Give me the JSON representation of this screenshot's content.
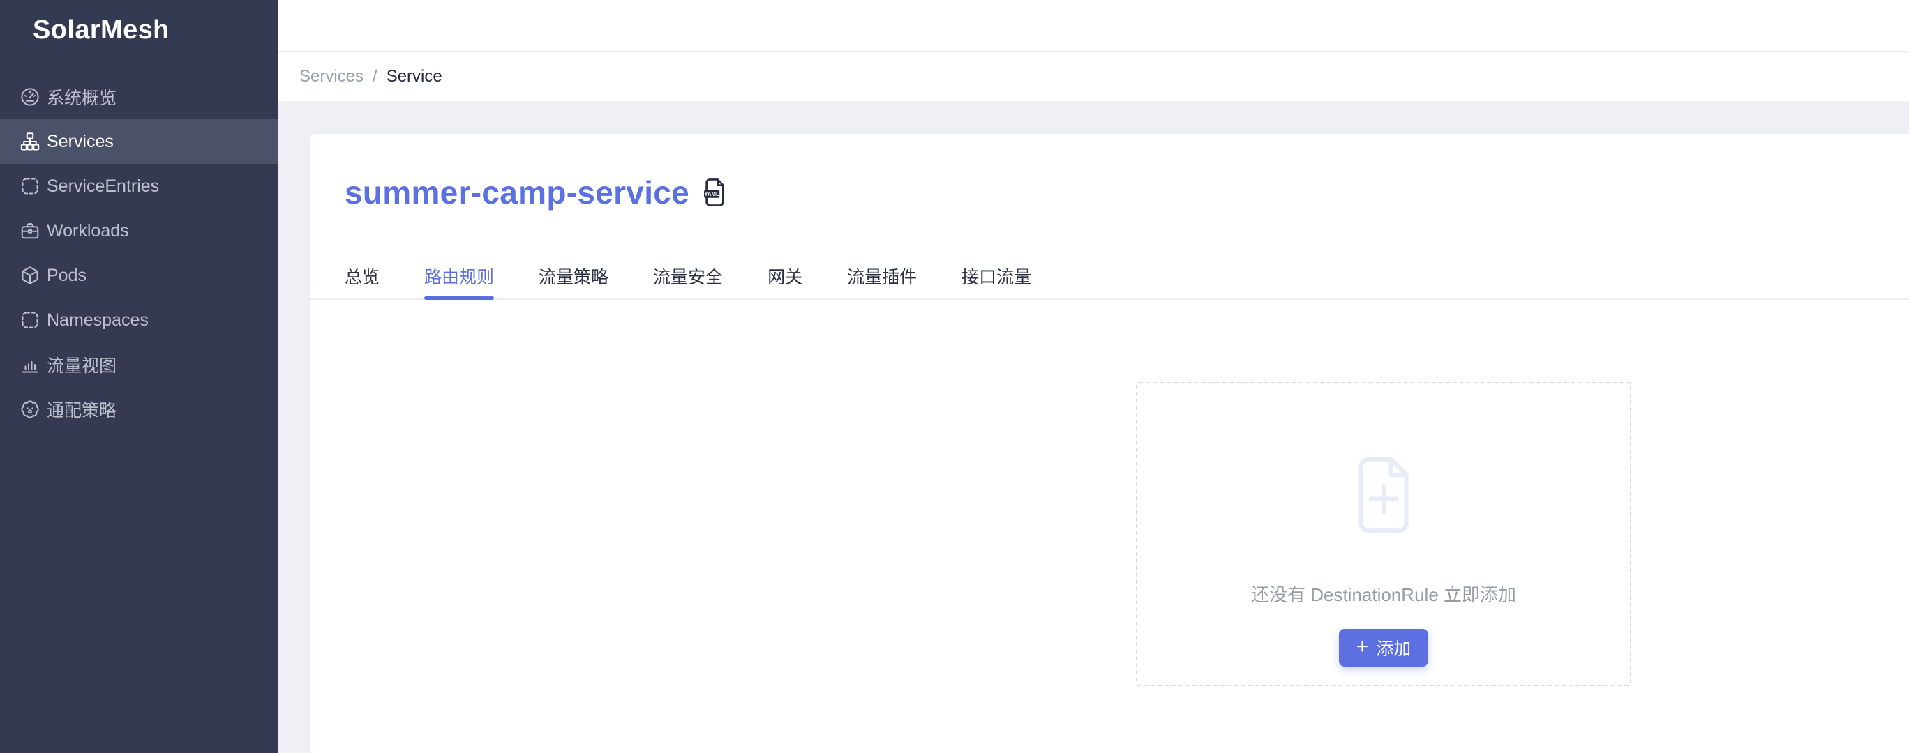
{
  "app": {
    "name": "SolarMesh"
  },
  "sidebar": {
    "items": [
      {
        "id": "system-overview",
        "label": "系统概览",
        "icon": "gauge-icon",
        "active": false
      },
      {
        "id": "services",
        "label": "Services",
        "icon": "sitemap-icon",
        "active": true
      },
      {
        "id": "service-entries",
        "label": "ServiceEntries",
        "icon": "dashed-square-icon",
        "active": false
      },
      {
        "id": "workloads",
        "label": "Workloads",
        "icon": "briefcase-icon",
        "active": false
      },
      {
        "id": "pods",
        "label": "Pods",
        "icon": "cube-icon",
        "active": false
      },
      {
        "id": "namespaces",
        "label": "Namespaces",
        "icon": "dashed-square-icon",
        "active": false
      },
      {
        "id": "traffic-view",
        "label": "流量视图",
        "icon": "bar-chart-icon",
        "active": false
      },
      {
        "id": "wildcard-policy",
        "label": "通配策略",
        "icon": "clover-icon",
        "active": false
      }
    ]
  },
  "breadcrumb": {
    "parent": "Services",
    "separator": "/",
    "current": "Service"
  },
  "page": {
    "title": "summer-camp-service",
    "title_icon": "yaml-file-icon",
    "yaml_badge": "YAML"
  },
  "tabs": [
    {
      "id": "overview",
      "label": "总览",
      "active": false
    },
    {
      "id": "routing-rules",
      "label": "路由规则",
      "active": true
    },
    {
      "id": "traffic-policy",
      "label": "流量策略",
      "active": false
    },
    {
      "id": "traffic-security",
      "label": "流量安全",
      "active": false
    },
    {
      "id": "gateway",
      "label": "网关",
      "active": false
    },
    {
      "id": "traffic-plugin",
      "label": "流量插件",
      "active": false
    },
    {
      "id": "interface-traffic",
      "label": "接口流量",
      "active": false
    }
  ],
  "empty_state": {
    "message": "还没有 DestinationRule 立即添加",
    "button": {
      "plus": "+",
      "label": "添加"
    },
    "icon": "file-plus-icon"
  },
  "colors": {
    "accent": "#5b6fe0",
    "title": "#5b70e2",
    "sidebar_bg": "#343a52",
    "sidebar_active_bg": "#4a5168",
    "content_bg": "#eef0f5",
    "dashed_border": "#d9dbe1",
    "muted_text": "#979ca6"
  }
}
